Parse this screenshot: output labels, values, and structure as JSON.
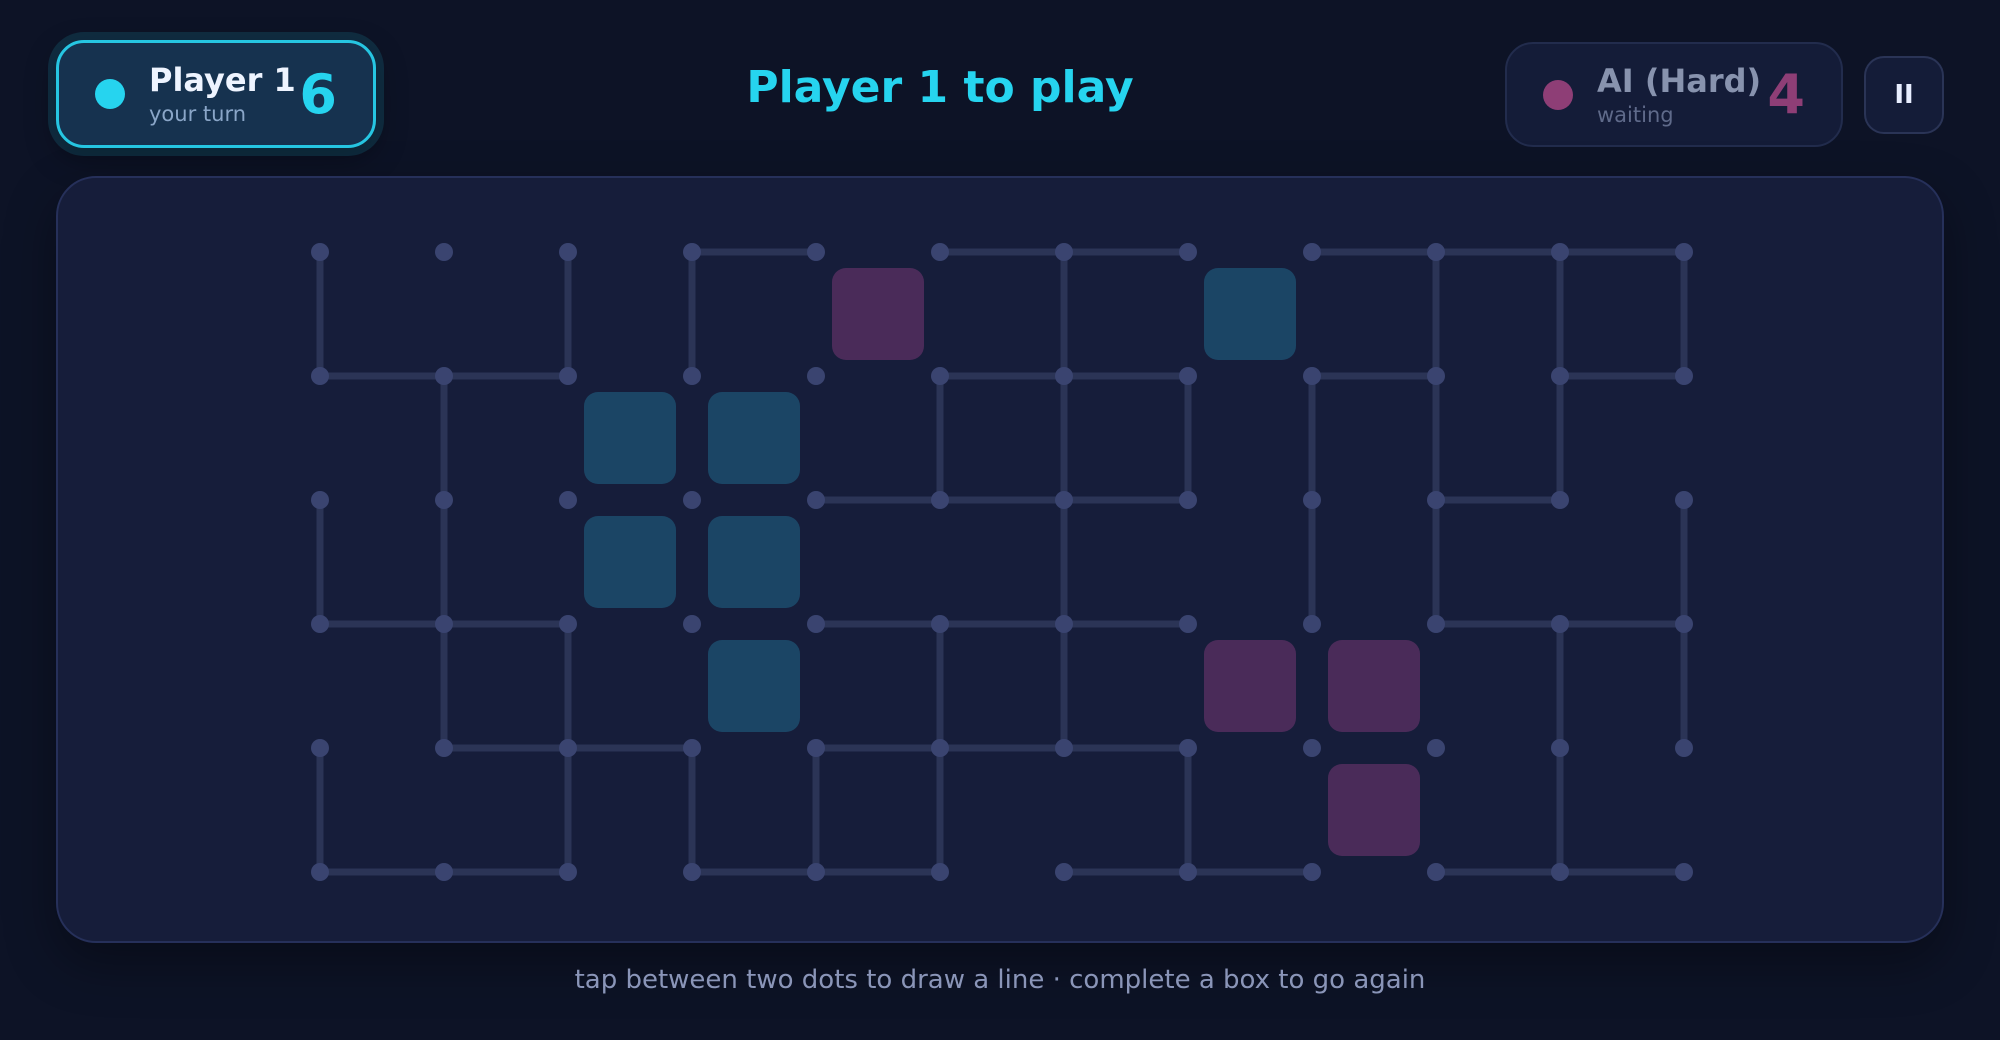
{
  "player1": {
    "name": "Player 1",
    "status": "your turn",
    "score": "6",
    "color": "#26d4ef"
  },
  "player2": {
    "name": "AI (Hard)",
    "status": "waiting",
    "score": "4",
    "color": "#8e3e76"
  },
  "turn_title": "Player 1 to play",
  "pause_icon": "pause-icon",
  "pause_label": "II",
  "hint": "tap between two dots to draw a line · complete a box to go again",
  "board": {
    "cols": 12,
    "rows": 6,
    "line_color": "#2b3456",
    "dot_color": "#3a4470",
    "p1_box_color": "#1b4565",
    "p2_box_color": "#4a2b59",
    "h_lines": [
      [
        3,
        0
      ],
      [
        5,
        0
      ],
      [
        6,
        0
      ],
      [
        8,
        0
      ],
      [
        9,
        0
      ],
      [
        10,
        0
      ],
      [
        0,
        1
      ],
      [
        1,
        1
      ],
      [
        5,
        1
      ],
      [
        6,
        1
      ],
      [
        8,
        1
      ],
      [
        10,
        1
      ],
      [
        4,
        2
      ],
      [
        5,
        2
      ],
      [
        6,
        2
      ],
      [
        9,
        2
      ],
      [
        0,
        3
      ],
      [
        1,
        3
      ],
      [
        4,
        3
      ],
      [
        5,
        3
      ],
      [
        6,
        3
      ],
      [
        9,
        3
      ],
      [
        10,
        3
      ],
      [
        1,
        4
      ],
      [
        2,
        4
      ],
      [
        4,
        4
      ],
      [
        5,
        4
      ],
      [
        6,
        4
      ],
      [
        0,
        5
      ],
      [
        1,
        5
      ],
      [
        3,
        5
      ],
      [
        4,
        5
      ],
      [
        6,
        5
      ],
      [
        7,
        5
      ],
      [
        9,
        5
      ],
      [
        10,
        5
      ]
    ],
    "v_lines": [
      [
        0,
        0
      ],
      [
        2,
        0
      ],
      [
        3,
        0
      ],
      [
        6,
        0
      ],
      [
        9,
        0
      ],
      [
        10,
        0
      ],
      [
        11,
        0
      ],
      [
        1,
        1
      ],
      [
        5,
        1
      ],
      [
        6,
        1
      ],
      [
        7,
        1
      ],
      [
        8,
        1
      ],
      [
        9,
        1
      ],
      [
        10,
        1
      ],
      [
        0,
        2
      ],
      [
        1,
        2
      ],
      [
        6,
        2
      ],
      [
        8,
        2
      ],
      [
        9,
        2
      ],
      [
        11,
        2
      ],
      [
        1,
        3
      ],
      [
        2,
        3
      ],
      [
        5,
        3
      ],
      [
        6,
        3
      ],
      [
        10,
        3
      ],
      [
        11,
        3
      ],
      [
        0,
        4
      ],
      [
        2,
        4
      ],
      [
        3,
        4
      ],
      [
        4,
        4
      ],
      [
        5,
        4
      ],
      [
        7,
        4
      ],
      [
        10,
        4
      ]
    ],
    "boxes": [
      {
        "col": 4,
        "row": 0,
        "owner": "p2"
      },
      {
        "col": 7,
        "row": 0,
        "owner": "p1"
      },
      {
        "col": 2,
        "row": 1,
        "owner": "p1"
      },
      {
        "col": 3,
        "row": 1,
        "owner": "p1"
      },
      {
        "col": 2,
        "row": 2,
        "owner": "p1"
      },
      {
        "col": 3,
        "row": 2,
        "owner": "p1"
      },
      {
        "col": 3,
        "row": 3,
        "owner": "p1"
      },
      {
        "col": 7,
        "row": 3,
        "owner": "p2"
      },
      {
        "col": 8,
        "row": 3,
        "owner": "p2"
      },
      {
        "col": 8,
        "row": 4,
        "owner": "p2"
      }
    ]
  }
}
